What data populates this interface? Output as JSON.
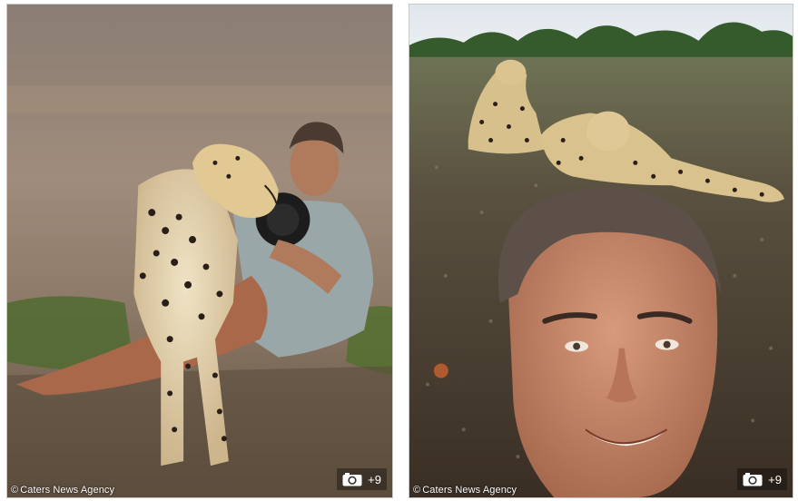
{
  "photos": [
    {
      "credit": "Caters News Agency",
      "copyright_symbol": "©",
      "gallery_count": "+9",
      "icon": "camera-icon"
    },
    {
      "credit": "Caters News Agency",
      "copyright_symbol": "©",
      "gallery_count": "+9",
      "icon": "camera-icon"
    }
  ],
  "colors": {
    "badge_bg": "#00000059",
    "credit_text": "#ffffff",
    "border": "#c9c9c9"
  }
}
